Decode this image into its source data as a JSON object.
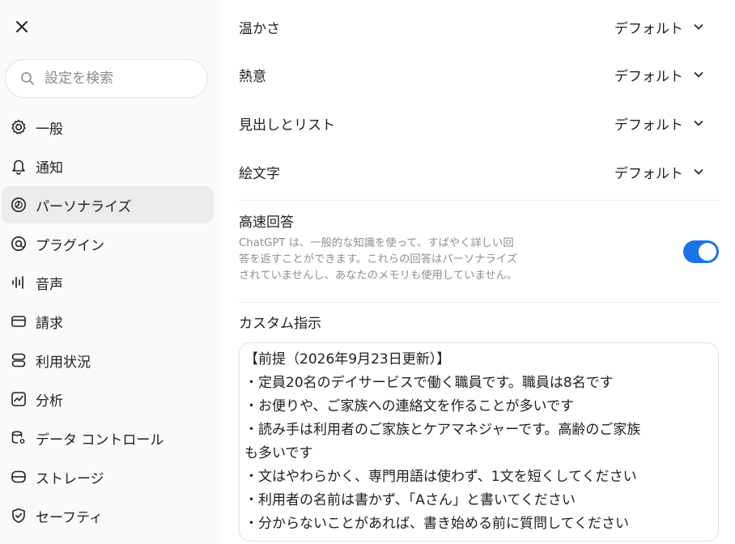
{
  "sidebar": {
    "search_placeholder": "設定を検索",
    "items": [
      {
        "label": "一般",
        "icon": "gear-icon"
      },
      {
        "label": "通知",
        "icon": "bell-icon"
      },
      {
        "label": "パーソナライズ",
        "icon": "personalize-icon",
        "active": true
      },
      {
        "label": "プラグイン",
        "icon": "plugin-icon"
      },
      {
        "label": "音声",
        "icon": "waveform-icon"
      },
      {
        "label": "請求",
        "icon": "card-icon"
      },
      {
        "label": "利用状況",
        "icon": "usage-icon"
      },
      {
        "label": "分析",
        "icon": "chart-icon"
      },
      {
        "label": "データ コントロール",
        "icon": "data-control-icon"
      },
      {
        "label": "ストレージ",
        "icon": "storage-icon"
      },
      {
        "label": "セーフティ",
        "icon": "shield-icon"
      }
    ]
  },
  "main": {
    "settings": [
      {
        "label": "温かさ",
        "value": "デフォルト"
      },
      {
        "label": "熱意",
        "value": "デフォルト"
      },
      {
        "label": "見出しとリスト",
        "value": "デフォルト"
      },
      {
        "label": "絵文字",
        "value": "デフォルト"
      }
    ],
    "fast_answer": {
      "title": "高速回答",
      "description_lines": [
        "ChatGPT は、一般的な知識を使って、すばやく詳しい回",
        "答を返すことができます。これらの回答はパーソナライズ",
        "されていませんし、あなたのメモリも使用していません。"
      ],
      "enabled": true
    },
    "custom_instructions": {
      "title": "カスタム指示",
      "lines": [
        "【前提（2026年9月23日更新）】",
        "・定員20名のデイサービスで働く職員です。職員は8名です",
        "・お便りや、ご家族への連絡文を作ることが多いです",
        "・読み手は利用者のご家族とケアマネジャーです。高齢のご家族",
        "も多いです",
        "・文はやわらかく、専門用語は使わず、1文を短くしてください",
        "・利用者の名前は書かず、「Aさん」と書いてください",
        "・分からないことがあれば、書き始める前に質問してください"
      ]
    }
  },
  "colors": {
    "toggle_on": "#1a73e8",
    "active_item_bg": "#ececec",
    "muted_text": "#8f8f8f"
  }
}
